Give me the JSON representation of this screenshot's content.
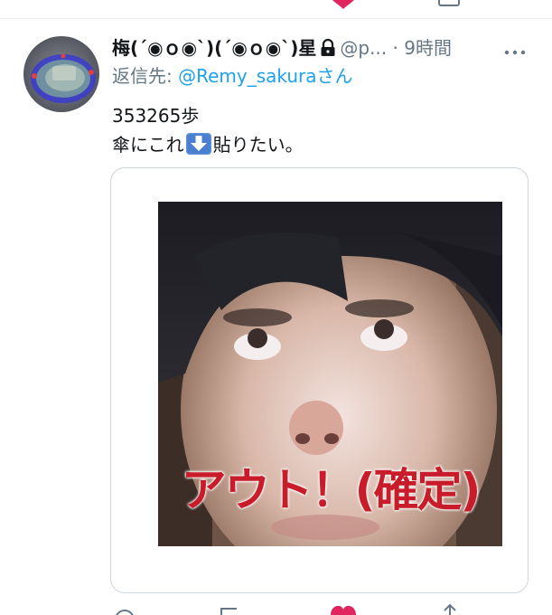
{
  "tweet": {
    "display_name": "梅(´◉ｏ◉`)(´◉ｏ◉`)星",
    "handle": "@p...",
    "separator": "·",
    "time": "9時間",
    "reply_prefix": "返信先: ",
    "reply_user": "@Remy_sakura",
    "reply_suffix": "さん",
    "text_line1": "353265歩",
    "text_line2_before": "傘にこれ",
    "text_line2_after": "貼りたい。",
    "media_caption": "アウト！(確定)"
  },
  "icons": {
    "lock": "lock-icon",
    "more": "more-icon",
    "arrow": "arrow-down-emoji",
    "reply": "reply-icon",
    "retweet": "retweet-icon",
    "like": "heart-icon",
    "share": "share-icon"
  },
  "colors": {
    "link": "#1da1f2",
    "secondary_text": "#657786",
    "like": "#e0245e",
    "caption": "#c91c2a"
  }
}
